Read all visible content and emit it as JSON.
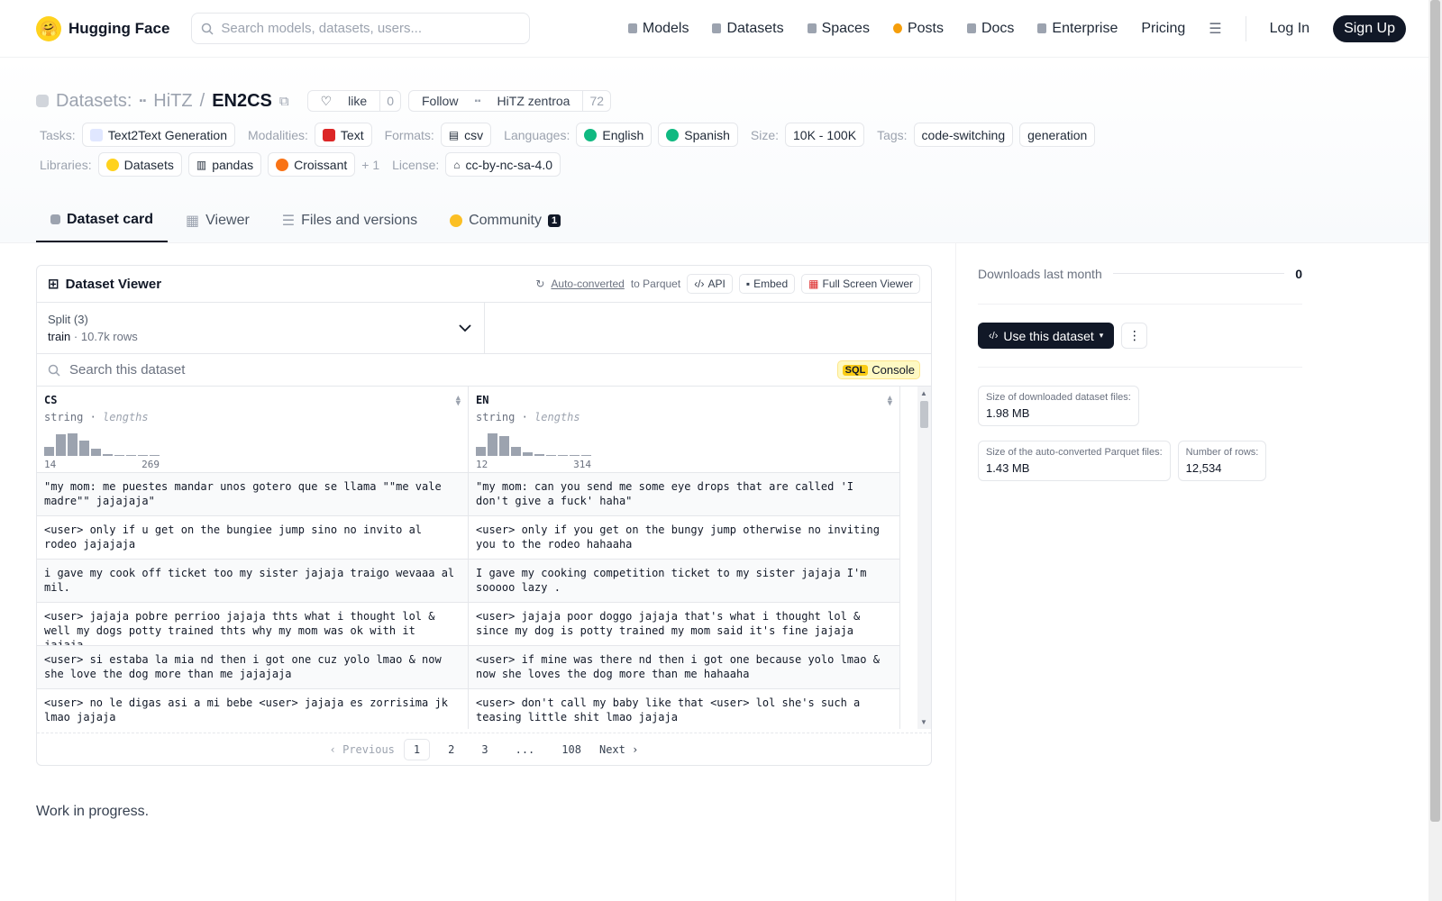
{
  "nav": {
    "brand": "Hugging Face",
    "search_placeholder": "Search models, datasets, users...",
    "links": [
      "Models",
      "Datasets",
      "Spaces",
      "Posts",
      "Docs",
      "Enterprise",
      "Pricing"
    ],
    "login": "Log In",
    "signup": "Sign Up"
  },
  "header": {
    "section": "Datasets:",
    "org": "HiTZ",
    "sep": "/",
    "name": "EN2CS",
    "like_label": "like",
    "like_count": "0",
    "follow_label": "Follow",
    "follow_org": "HiTZ zentroa",
    "follow_count": "72",
    "row1": {
      "tasks_label": "Tasks:",
      "task": "Text2Text Generation",
      "modalities_label": "Modalities:",
      "modality": "Text",
      "formats_label": "Formats:",
      "format": "csv",
      "languages_label": "Languages:",
      "lang1": "English",
      "lang2": "Spanish",
      "size_label": "Size:",
      "size": "10K - 100K",
      "tags_label": "Tags:",
      "tag1": "code-switching",
      "tag2": "generation"
    },
    "row2": {
      "libraries_label": "Libraries:",
      "lib1": "Datasets",
      "lib2": "pandas",
      "lib3": "Croissant",
      "more": "+ 1",
      "license_label": "License:",
      "license": "cc-by-nc-sa-4.0"
    },
    "tabs": [
      "Dataset card",
      "Viewer",
      "Files and versions",
      "Community"
    ],
    "community_badge": "1"
  },
  "viewer": {
    "title": "Dataset Viewer",
    "autoconv": "Auto-converted",
    "to_parquet": "to Parquet",
    "api": "API",
    "embed": "Embed",
    "fullscreen": "Full Screen Viewer",
    "split_label": "Split (3)",
    "split_name": "train",
    "split_dot": "·",
    "split_rows": "10.7k rows",
    "search_placeholder": "Search this dataset",
    "sql": "SQL",
    "console": "Console",
    "columns": [
      {
        "name": "CS",
        "type": "string",
        "stat": "lengths",
        "min": "14",
        "max": "269"
      },
      {
        "name": "EN",
        "type": "string",
        "stat": "lengths",
        "min": "12",
        "max": "314"
      }
    ],
    "rows": [
      [
        "\"my mom: me puestes mandar unos gotero que se llama \"\"me vale madre\"\" jajajaja\"",
        "\"my mom: can you send me some eye drops that are called 'I don't give a fuck' haha\""
      ],
      [
        "<user> only if u get on the bungiee jump sino no invito al rodeo jajajaja",
        "<user> only if you get on the bungy jump otherwise no inviting you to the rodeo hahaaha"
      ],
      [
        "i gave my cook off ticket too my sister jajaja traigo wevaaa al mil.",
        "I gave my cooking competition ticket to my sister jajaja I'm sooooo lazy ."
      ],
      [
        "<user> jajaja pobre perrioo jajaja thts what i thought lol & well my dogs potty trained thts why my mom was ok with it jajaja",
        "<user> jajaja poor doggo jajaja that's what i thought lol & since my dog is potty trained my mom said it's fine jajaja"
      ],
      [
        "<user> si estaba la mia nd then i got one cuz yolo lmao & now she love the dog more than me jajajaja",
        "<user> if mine was there nd then i got one because yolo lmao & now she loves the dog more than me hahaaha"
      ],
      [
        "<user> no le digas asi a mi bebe <user> jajaja es zorrisima jk lmao jajaja",
        "<user> don't call my baby like that <user> lol she's such a teasing little shit lmao jajaja"
      ]
    ],
    "pager": {
      "prev": "Previous",
      "pages": [
        "1",
        "2",
        "3",
        "...",
        "108"
      ],
      "next": "Next"
    }
  },
  "body_text": "Work in progress.",
  "sidebar": {
    "downloads_label": "Downloads last month",
    "downloads_value": "0",
    "use_label": "Use this dataset",
    "stats": [
      {
        "k": "Size of downloaded dataset files:",
        "v": "1.98 MB"
      },
      {
        "k": "Size of the auto-converted Parquet files:",
        "v": "1.43 MB"
      },
      {
        "k": "Number of rows:",
        "v": "12,534"
      }
    ]
  },
  "histograms": {
    "cs": [
      0.35,
      0.85,
      0.9,
      0.6,
      0.3,
      0.08,
      0.05,
      0.05,
      0.05,
      0.05
    ],
    "en": [
      0.35,
      0.9,
      0.8,
      0.35,
      0.15,
      0.08,
      0.05,
      0.05,
      0.05,
      0.05
    ]
  },
  "colors": {
    "brand_yellow": "#ffd21e",
    "dark": "#111827",
    "sql_yellow": "#facc15"
  }
}
